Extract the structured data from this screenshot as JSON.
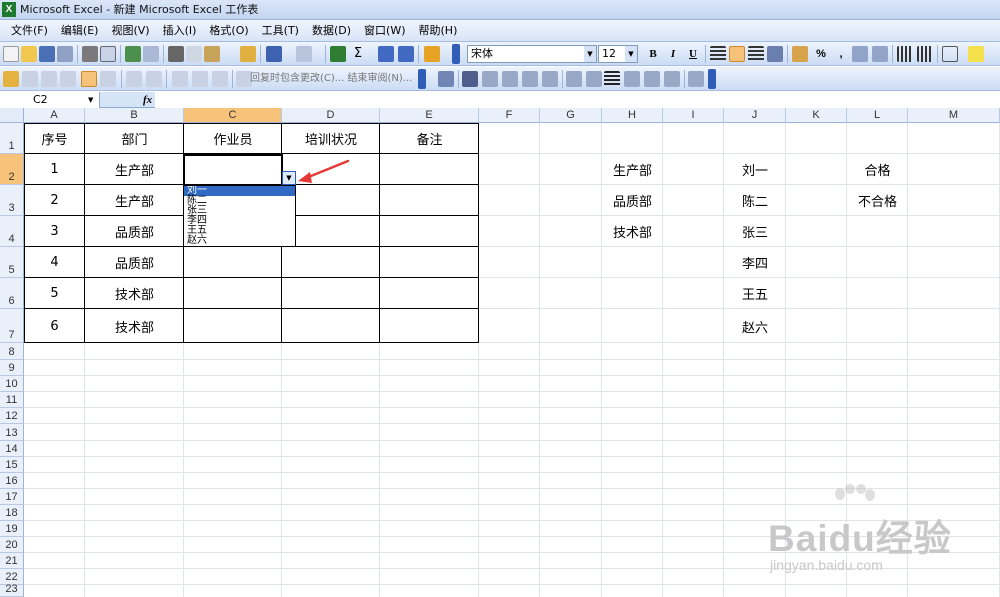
{
  "window": {
    "title": "Microsoft Excel - 新建 Microsoft Excel 工作表",
    "app_icon": "X"
  },
  "menu": [
    {
      "label": "文件(F)"
    },
    {
      "label": "编辑(E)"
    },
    {
      "label": "视图(V)"
    },
    {
      "label": "插入(I)"
    },
    {
      "label": "格式(O)"
    },
    {
      "label": "工具(T)"
    },
    {
      "label": "数据(D)"
    },
    {
      "label": "窗口(W)"
    },
    {
      "label": "帮助(H)"
    }
  ],
  "toolbar": {
    "font_name": "宋体",
    "font_size": "12",
    "bold": "B",
    "italic": "I",
    "underline": "U",
    "sum": "Σ",
    "percent": "%",
    "comma": ",",
    "review_text": "回复时包含更改(C)...  结束审阅(N)..."
  },
  "formula_bar": {
    "name_box": "C2",
    "fx": "fx",
    "content": ""
  },
  "columns": [
    "A",
    "B",
    "C",
    "D",
    "E",
    "F",
    "G",
    "H",
    "I",
    "J",
    "K",
    "L",
    "M"
  ],
  "rows": [
    "1",
    "2",
    "3",
    "4",
    "5",
    "6",
    "7",
    "8",
    "9",
    "10",
    "11",
    "12",
    "13",
    "14",
    "15",
    "16",
    "17",
    "18",
    "19",
    "20",
    "21",
    "22",
    "23"
  ],
  "table": {
    "headers": [
      "序号",
      "部门",
      "作业员",
      "培训状况",
      "备注"
    ],
    "rows": [
      [
        "1",
        "生产部",
        "",
        "",
        ""
      ],
      [
        "2",
        "生产部",
        "",
        "",
        ""
      ],
      [
        "3",
        "品质部",
        "",
        "",
        ""
      ],
      [
        "4",
        "品质部",
        "",
        "",
        ""
      ],
      [
        "5",
        "技术部",
        "",
        "",
        ""
      ],
      [
        "6",
        "技术部",
        "",
        "",
        ""
      ]
    ]
  },
  "lists": {
    "departments": [
      "生产部",
      "品质部",
      "技术部"
    ],
    "workers": [
      "刘一",
      "陈二",
      "张三",
      "李四",
      "王五",
      "赵六"
    ],
    "status": [
      "合格",
      "不合格"
    ]
  },
  "dropdown": {
    "items": [
      "刘一",
      "陈二",
      "张三",
      "李四",
      "王五",
      "赵六"
    ],
    "selected_index": 0
  },
  "watermark": {
    "text": "Baidu经验",
    "url": "jingyan.baidu.com"
  },
  "colors": {
    "active_header": "#f7c27a",
    "selection_blue": "#316ac5",
    "arrow_red": "#e53935"
  }
}
